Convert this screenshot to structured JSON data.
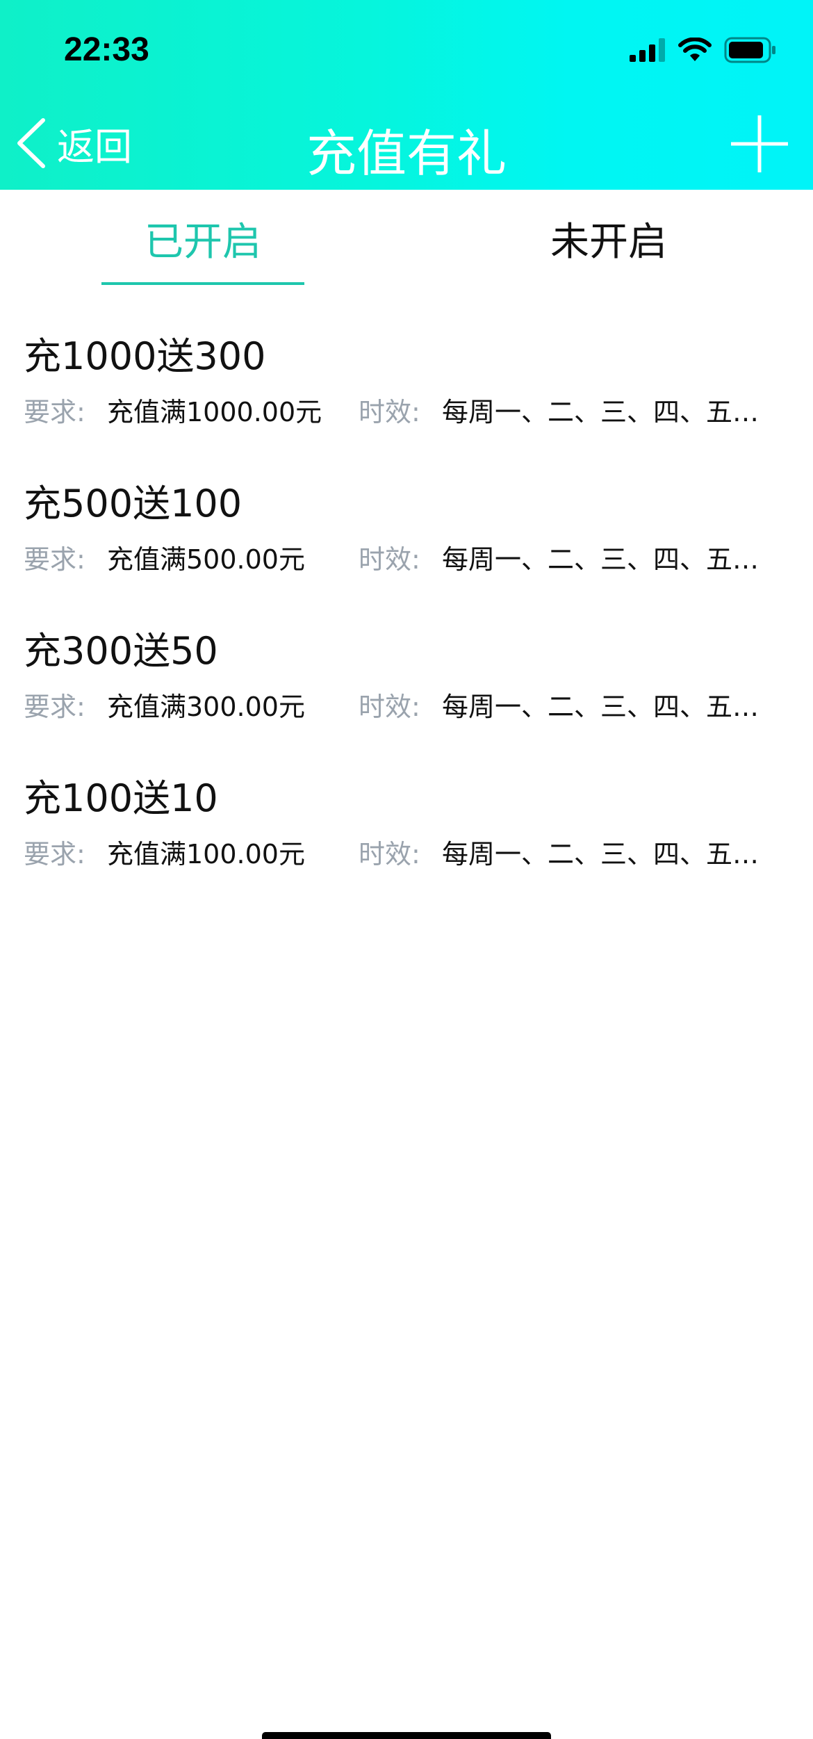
{
  "status_bar": {
    "time": "22:33"
  },
  "navbar": {
    "back_label": "返回",
    "title": "充值有礼"
  },
  "tabs": [
    {
      "label": "已开启",
      "active": true
    },
    {
      "label": "未开启",
      "active": false
    }
  ],
  "items": [
    {
      "title": "充1000送300",
      "requirement_label": "要求:",
      "requirement_value": "充值满1000.00元",
      "validity_label": "时效:",
      "validity_value": "每周一、二、三、四、五…"
    },
    {
      "title": "充500送100",
      "requirement_label": "要求:",
      "requirement_value": "充值满500.00元",
      "validity_label": "时效:",
      "validity_value": "每周一、二、三、四、五…"
    },
    {
      "title": "充300送50",
      "requirement_label": "要求:",
      "requirement_value": "充值满300.00元",
      "validity_label": "时效:",
      "validity_value": "每周一、二、三、四、五…"
    },
    {
      "title": "充100送10",
      "requirement_label": "要求:",
      "requirement_value": "充值满100.00元",
      "validity_label": "时效:",
      "validity_value": "每周一、二、三、四、五…"
    }
  ],
  "icons": {
    "back": "chevron-left-icon",
    "add": "plus-icon",
    "signal": "cellular-signal-icon",
    "wifi": "wifi-icon",
    "battery": "battery-icon"
  },
  "colors": {
    "accent": "#1ec6ad",
    "header_gradient_start": "#0ff0c8",
    "header_gradient_end": "#00f4f8",
    "label_gray": "#9aa3ad",
    "text_dark": "#111111"
  }
}
